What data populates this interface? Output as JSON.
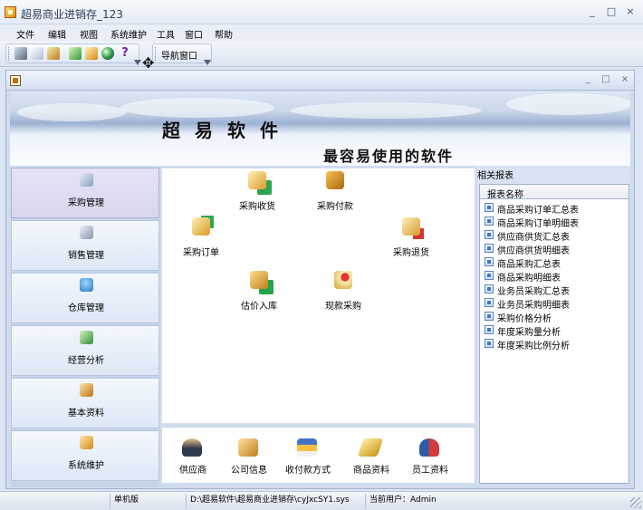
{
  "window": {
    "title": "超易商业进销存_123",
    "controls": [
      "_",
      "□",
      "×"
    ]
  },
  "menu": [
    "文件",
    "编辑",
    "视图",
    "系统维护",
    "工具",
    "窗口",
    "帮助"
  ],
  "toolbar": {
    "icons": [
      "cut-icon",
      "copy-icon",
      "paste-icon",
      "refresh-icon",
      "chart-icon",
      "globe-icon",
      "help-icon"
    ],
    "help_label": "?",
    "nav_window_button": "导航窗口"
  },
  "child_window": {
    "controls": [
      "_",
      "□",
      "×"
    ]
  },
  "banner": {
    "title": "超易软件",
    "subtitle": "最容易使用的软件"
  },
  "left_nav": {
    "items": [
      {
        "label": "采购管理",
        "icon": "purchase-icon",
        "active": true
      },
      {
        "label": "销售管理",
        "icon": "sales-icon",
        "active": false
      },
      {
        "label": "仓库管理",
        "icon": "warehouse-icon",
        "active": false
      },
      {
        "label": "经营分析",
        "icon": "analysis-icon",
        "active": false
      },
      {
        "label": "基本资料",
        "icon": "basic-data-icon",
        "active": false
      },
      {
        "label": "系统维护",
        "icon": "system-maintenance-icon",
        "active": false
      }
    ]
  },
  "functions": {
    "purchase_receive": {
      "label": "采购收货",
      "icon": "receive-goods-icon"
    },
    "purchase_payment": {
      "label": "采购付款",
      "icon": "payment-icon"
    },
    "purchase_order": {
      "label": "采购订单",
      "icon": "purchase-order-icon"
    },
    "purchase_return": {
      "label": "采购退货",
      "icon": "purchase-return-icon"
    },
    "estimated_stock_in": {
      "label": "估价入库",
      "icon": "stock-in-icon"
    },
    "cash_purchase": {
      "label": "现款采购",
      "icon": "cash-purchase-icon"
    }
  },
  "bottom_panel": {
    "items": [
      {
        "label": "供应商",
        "icon": "supplier-icon"
      },
      {
        "label": "公司信息",
        "icon": "company-info-icon"
      },
      {
        "label": "收付款方式",
        "icon": "payment-method-icon"
      },
      {
        "label": "商品资料",
        "icon": "product-data-icon"
      },
      {
        "label": "员工资料",
        "icon": "employee-data-icon"
      }
    ]
  },
  "reports": {
    "title": "相关报表",
    "header": "报表名称",
    "items": [
      "商品采购订单汇总表",
      "商品采购订单明细表",
      "供应商供货汇总表",
      "供应商供货明细表",
      "商品采购汇总表",
      "商品采购明细表",
      "业务员采购汇总表",
      "业务员采购明细表",
      "采购价格分析",
      "年度采购量分析",
      "年度采购比例分析"
    ]
  },
  "statusbar": {
    "cell1": "",
    "edition": "单机版",
    "path": "D:\\超易软件\\超易商业进销存\\cyJxcSY1.sys",
    "current_user": "当前用户：Admin"
  },
  "colors": {
    "titlebar": "#e4ebf6",
    "active_nav": "#d9d7ef",
    "accent_blue": "#3b77c9"
  }
}
